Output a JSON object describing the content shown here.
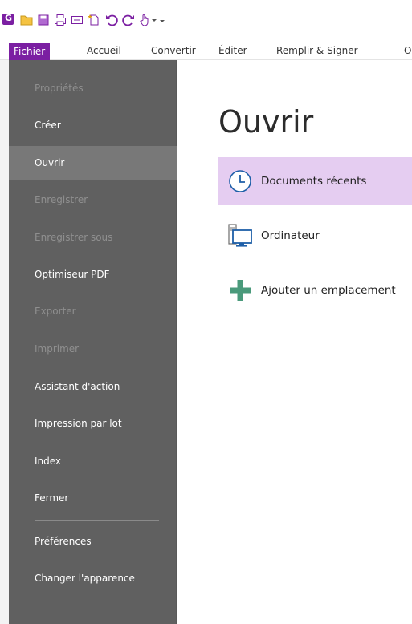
{
  "tabs": [
    {
      "label": "Fichier"
    },
    {
      "label": "Accueil"
    },
    {
      "label": "Convertir"
    },
    {
      "label": "Éditer"
    },
    {
      "label": "Remplir & Signer"
    },
    {
      "label": "O"
    }
  ],
  "sidebar": {
    "items": [
      {
        "label": "Propriétés",
        "state": "disabled"
      },
      {
        "label": "Créer",
        "state": "normal"
      },
      {
        "label": "Ouvrir",
        "state": "selected"
      },
      {
        "label": "Enregistrer",
        "state": "disabled"
      },
      {
        "label": "Enregistrer sous",
        "state": "disabled"
      },
      {
        "label": "Optimiseur PDF",
        "state": "normal"
      },
      {
        "label": "Exporter",
        "state": "disabled"
      },
      {
        "label": "Imprimer",
        "state": "disabled"
      },
      {
        "label": "Assistant d'action",
        "state": "normal"
      },
      {
        "label": "Impression par lot",
        "state": "normal"
      },
      {
        "label": "Index",
        "state": "normal"
      },
      {
        "label": "Fermer",
        "state": "normal"
      },
      {
        "label": "Préférences",
        "state": "normal"
      },
      {
        "label": "Changer l'apparence",
        "state": "normal"
      }
    ]
  },
  "main": {
    "title": "Ouvrir",
    "options": [
      {
        "label": "Documents récents",
        "icon": "clock-icon",
        "active": true
      },
      {
        "label": "Ordinateur",
        "icon": "computer-icon",
        "active": false
      },
      {
        "label": "Ajouter un emplacement",
        "icon": "plus-icon",
        "active": false
      }
    ]
  },
  "colors": {
    "accent": "#7b1fa2",
    "sidebar_bg": "#606060",
    "sidebar_selected": "#787878",
    "option_selected": "#e5cdf1"
  }
}
